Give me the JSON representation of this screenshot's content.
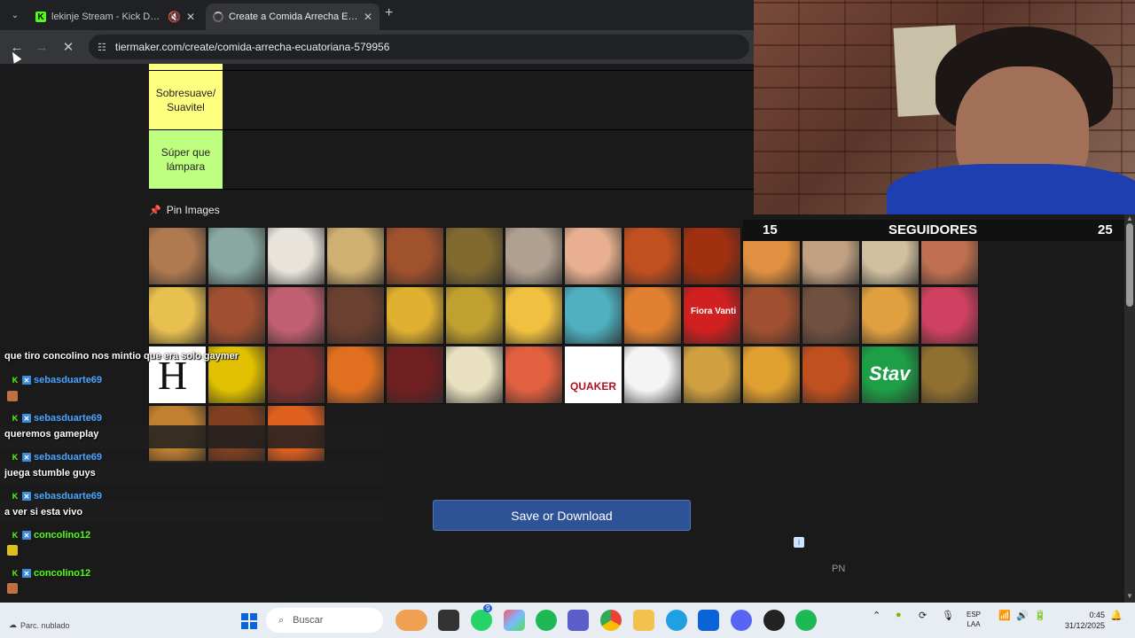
{
  "browser": {
    "tabs": [
      {
        "title": "lekinje Stream - Kick Dashb",
        "active": false
      },
      {
        "title": "Create a Comida Arrecha Ecuat",
        "active": true
      }
    ],
    "url": "tiermaker.com/create/comida-arrecha-ecuatoriana-579956"
  },
  "tierlist": {
    "rows": [
      {
        "label": "",
        "color": "#ffff7f"
      },
      {
        "label": "Sobresuave/ Suavitel",
        "color": "#ffff7f"
      },
      {
        "label": "Súper que lámpara",
        "color": "#bfff7f"
      }
    ],
    "pin_label": "Pin Images",
    "save_label": "Save or Download",
    "tile_text": {
      "letter": "H",
      "quaker": "QUAKER",
      "stav": "Stav",
      "fioravanti": "Fiora Vanti"
    }
  },
  "overlay": {
    "follow_left": "15",
    "follow_label": "SEGUIDORES",
    "follow_right": "25"
  },
  "chat": [
    {
      "kind": "message",
      "text": "que tiro concolino nos mintio que era solo gaymer"
    },
    {
      "kind": "user",
      "name": "sebasduarte69",
      "color": "#4aa3ff"
    },
    {
      "kind": "user",
      "name": "sebasduarte69",
      "color": "#4aa3ff"
    },
    {
      "kind": "message",
      "text": "queremos gameplay"
    },
    {
      "kind": "user",
      "name": "sebasduarte69",
      "color": "#4aa3ff"
    },
    {
      "kind": "message",
      "text": "juega stumble guys"
    },
    {
      "kind": "user",
      "name": "sebasduarte69",
      "color": "#4aa3ff"
    },
    {
      "kind": "message",
      "text": "a ver si esta vivo"
    },
    {
      "kind": "user",
      "name": "concolino12",
      "color": "#53fc18"
    },
    {
      "kind": "user",
      "name": "concolino12",
      "color": "#53fc18"
    },
    {
      "kind": "user",
      "name": "concolino12",
      "color": "#53fc18"
    }
  ],
  "page_misc": {
    "pn": "PN",
    "ad_icon": "i"
  },
  "taskbar": {
    "weather": "Parc. nublado",
    "search_placeholder": "Buscar",
    "lang_top": "ESP",
    "lang_bottom": "LAA",
    "time": "0:45",
    "date": "31/12/2025",
    "whatsapp_badge": "9"
  }
}
